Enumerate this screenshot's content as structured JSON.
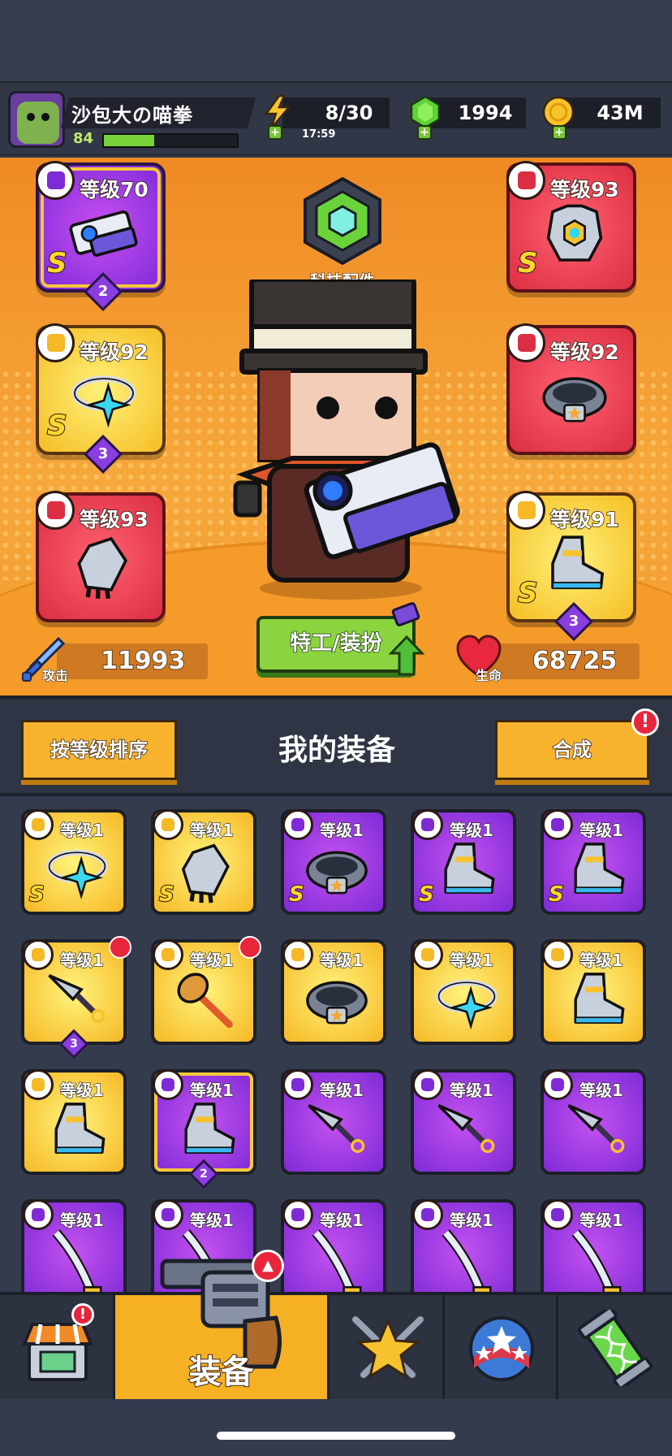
{
  "player": {
    "name": "沙包大の喵拳",
    "level": "84",
    "xp_fraction": 0.38
  },
  "resources": {
    "energy": {
      "value": "8/30",
      "timer": "17:59"
    },
    "gems": {
      "value": "1994"
    },
    "coins": {
      "value": "43M"
    }
  },
  "tech_parts": {
    "label": "科技配件"
  },
  "equipped": [
    {
      "id": "weapon",
      "level_text": "等级70",
      "rank": "S",
      "stars": "2",
      "style": "purple"
    },
    {
      "id": "armor",
      "level_text": "等级93",
      "rank": "S",
      "stars": "",
      "style": "red"
    },
    {
      "id": "necklace",
      "level_text": "等级92",
      "rank": "S",
      "stars": "3",
      "style": "gold"
    },
    {
      "id": "belt",
      "level_text": "等级92",
      "rank": "",
      "stars": "",
      "style": "red"
    },
    {
      "id": "gloves",
      "level_text": "等级93",
      "rank": "",
      "stars": "",
      "style": "red"
    },
    {
      "id": "boots",
      "level_text": "等级91",
      "rank": "S",
      "stars": "3",
      "style": "gold"
    }
  ],
  "stats": {
    "attack_label": "攻击",
    "attack": "11993",
    "hp_label": "生命",
    "hp": "68725"
  },
  "agent_button": {
    "label": "特工/装扮"
  },
  "inventory": {
    "sort_label": "按等级排序",
    "title": "我的装备",
    "merge_label": "合成",
    "merge_alert": "!",
    "items": [
      {
        "level_text": "等级1",
        "rank": "S",
        "stars": "",
        "style": "gold",
        "kind": "necklace",
        "new": false
      },
      {
        "level_text": "等级1",
        "rank": "S",
        "stars": "",
        "style": "gold",
        "kind": "gloves",
        "new": false
      },
      {
        "level_text": "等级1",
        "rank": "S",
        "stars": "",
        "style": "purple",
        "kind": "belt",
        "new": false
      },
      {
        "level_text": "等级1",
        "rank": "S",
        "stars": "",
        "style": "purple",
        "kind": "boots",
        "new": false
      },
      {
        "level_text": "等级1",
        "rank": "S",
        "stars": "",
        "style": "purple",
        "kind": "boots",
        "new": false
      },
      {
        "level_text": "等级1",
        "rank": "",
        "stars": "3",
        "style": "gold",
        "kind": "kunai",
        "new": true
      },
      {
        "level_text": "等级1",
        "rank": "",
        "stars": "",
        "style": "gold",
        "kind": "club",
        "new": true
      },
      {
        "level_text": "等级1",
        "rank": "",
        "stars": "",
        "style": "gold",
        "kind": "belt",
        "new": false
      },
      {
        "level_text": "等级1",
        "rank": "",
        "stars": "",
        "style": "gold",
        "kind": "necklace",
        "new": false
      },
      {
        "level_text": "等级1",
        "rank": "",
        "stars": "",
        "style": "gold",
        "kind": "boots",
        "new": false
      },
      {
        "level_text": "等级1",
        "rank": "",
        "stars": "",
        "style": "gold",
        "kind": "boots",
        "new": false
      },
      {
        "level_text": "等级1",
        "rank": "",
        "stars": "2",
        "style": "gold-purple",
        "kind": "boots",
        "new": false
      },
      {
        "level_text": "等级1",
        "rank": "",
        "stars": "",
        "style": "purple",
        "kind": "kunai",
        "new": false
      },
      {
        "level_text": "等级1",
        "rank": "",
        "stars": "",
        "style": "purple",
        "kind": "kunai",
        "new": false
      },
      {
        "level_text": "等级1",
        "rank": "",
        "stars": "",
        "style": "purple",
        "kind": "kunai",
        "new": false
      },
      {
        "level_text": "等级1",
        "rank": "",
        "stars": "",
        "style": "purple",
        "kind": "sword",
        "new": false
      },
      {
        "level_text": "等级1",
        "rank": "",
        "stars": "",
        "style": "purple",
        "kind": "sword",
        "new": false
      },
      {
        "level_text": "等级1",
        "rank": "",
        "stars": "",
        "style": "purple",
        "kind": "sword",
        "new": false
      },
      {
        "level_text": "等级1",
        "rank": "",
        "stars": "",
        "style": "purple",
        "kind": "sword",
        "new": false
      },
      {
        "level_text": "等级1",
        "rank": "",
        "stars": "",
        "style": "purple",
        "kind": "sword",
        "new": false
      }
    ]
  },
  "nav": {
    "tabs": [
      {
        "id": "shop",
        "label": "",
        "icon": "shop-icon",
        "alert": "!"
      },
      {
        "id": "equipment",
        "label": "装备",
        "icon": "revolver-icon",
        "active": true
      },
      {
        "id": "battle",
        "label": "",
        "icon": "crossed-swords-star-icon"
      },
      {
        "id": "talent",
        "label": "",
        "icon": "star-ball-icon"
      },
      {
        "id": "evolve",
        "label": "",
        "icon": "dna-capsule-icon"
      }
    ]
  },
  "colors": {
    "gold": "#f6b825",
    "purple": "#7e2ad6",
    "red": "#dc2e43",
    "stage": "#f29a2f",
    "accent_green": "#8bd43f"
  }
}
